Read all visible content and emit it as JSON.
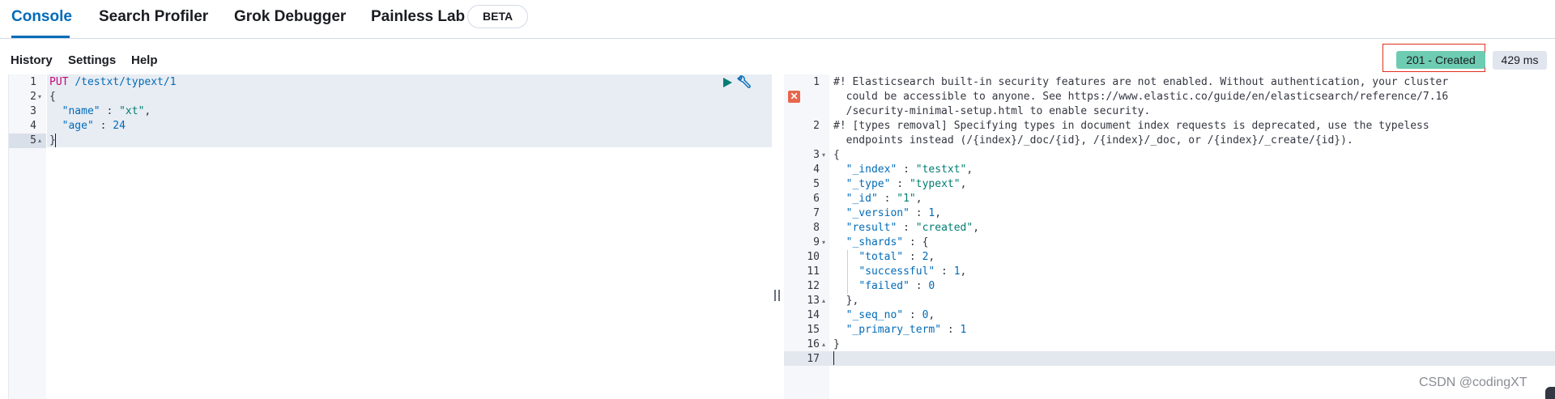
{
  "tabs": [
    {
      "label": "Console"
    },
    {
      "label": "Search Profiler"
    },
    {
      "label": "Grok Debugger"
    },
    {
      "label": "Painless Lab"
    }
  ],
  "beta_badge": "BETA",
  "menu": {
    "history": "History",
    "settings": "Settings",
    "help": "Help"
  },
  "status": {
    "code_text": "201 - Created",
    "time_text": "429 ms",
    "color": "#6dccb1"
  },
  "request": {
    "line_numbers": [
      "1",
      "2",
      "3",
      "4",
      "5"
    ],
    "method": "PUT",
    "url": "/testxt/typext/1",
    "lines": [
      {
        "indent": "",
        "text": "{"
      },
      {
        "indent": "  ",
        "key": "\"name\"",
        "sep": " : ",
        "value": "\"xt\"",
        "tail": ","
      },
      {
        "indent": "  ",
        "key": "\"age\"",
        "sep": " : ",
        "value": "24",
        "tail": ""
      },
      {
        "indent": "",
        "text": "}"
      }
    ]
  },
  "response": {
    "line_numbers": [
      "1",
      "",
      "",
      "2",
      "",
      "3",
      "4",
      "5",
      "6",
      "7",
      "8",
      "9",
      "10",
      "11",
      "12",
      "13",
      "14",
      "15",
      "16",
      "17"
    ],
    "warning1": [
      "#! Elasticsearch built-in security features are not enabled. Without authentication, your cluster",
      "  could be accessible to anyone. See https://www.elastic.co/guide/en/elasticsearch/reference/7.16",
      "  /security-minimal-setup.html to enable security."
    ],
    "warning2": [
      "#! [types removal] Specifying types in document index requests is deprecated, use the typeless",
      "  endpoints instead (/{index}/_doc/{id}, /{index}/_doc, or /{index}/_create/{id})."
    ],
    "json": [
      {
        "indent": "",
        "text": "{"
      },
      {
        "indent": "  ",
        "key": "\"_index\"",
        "sep": " : ",
        "value": "\"testxt\"",
        "tail": ",",
        "vtype": "str"
      },
      {
        "indent": "  ",
        "key": "\"_type\"",
        "sep": " : ",
        "value": "\"typext\"",
        "tail": ",",
        "vtype": "str"
      },
      {
        "indent": "  ",
        "key": "\"_id\"",
        "sep": " : ",
        "value": "\"1\"",
        "tail": ",",
        "vtype": "str"
      },
      {
        "indent": "  ",
        "key": "\"_version\"",
        "sep": " : ",
        "value": "1",
        "tail": ",",
        "vtype": "num"
      },
      {
        "indent": "  ",
        "key": "\"result\"",
        "sep": " : ",
        "value": "\"created\"",
        "tail": ",",
        "vtype": "str"
      },
      {
        "indent": "  ",
        "key": "\"_shards\"",
        "sep": " : ",
        "value": "{",
        "tail": "",
        "vtype": "punct"
      },
      {
        "indent": "    ",
        "key": "\"total\"",
        "sep": " : ",
        "value": "2",
        "tail": ",",
        "vtype": "num"
      },
      {
        "indent": "    ",
        "key": "\"successful\"",
        "sep": " : ",
        "value": "1",
        "tail": ",",
        "vtype": "num"
      },
      {
        "indent": "    ",
        "key": "\"failed\"",
        "sep": " : ",
        "value": "0",
        "tail": "",
        "vtype": "num"
      },
      {
        "indent": "  ",
        "text": "},"
      },
      {
        "indent": "  ",
        "key": "\"_seq_no\"",
        "sep": " : ",
        "value": "0",
        "tail": ",",
        "vtype": "num"
      },
      {
        "indent": "  ",
        "key": "\"_primary_term\"",
        "sep": " : ",
        "value": "1",
        "tail": "",
        "vtype": "num"
      },
      {
        "indent": "",
        "text": "}"
      },
      {
        "indent": "",
        "text": ""
      }
    ]
  },
  "icons": {
    "run": "play-icon",
    "wrench": "wrench-icon",
    "error": "error-icon"
  },
  "watermark": "CSDN @codingXT"
}
